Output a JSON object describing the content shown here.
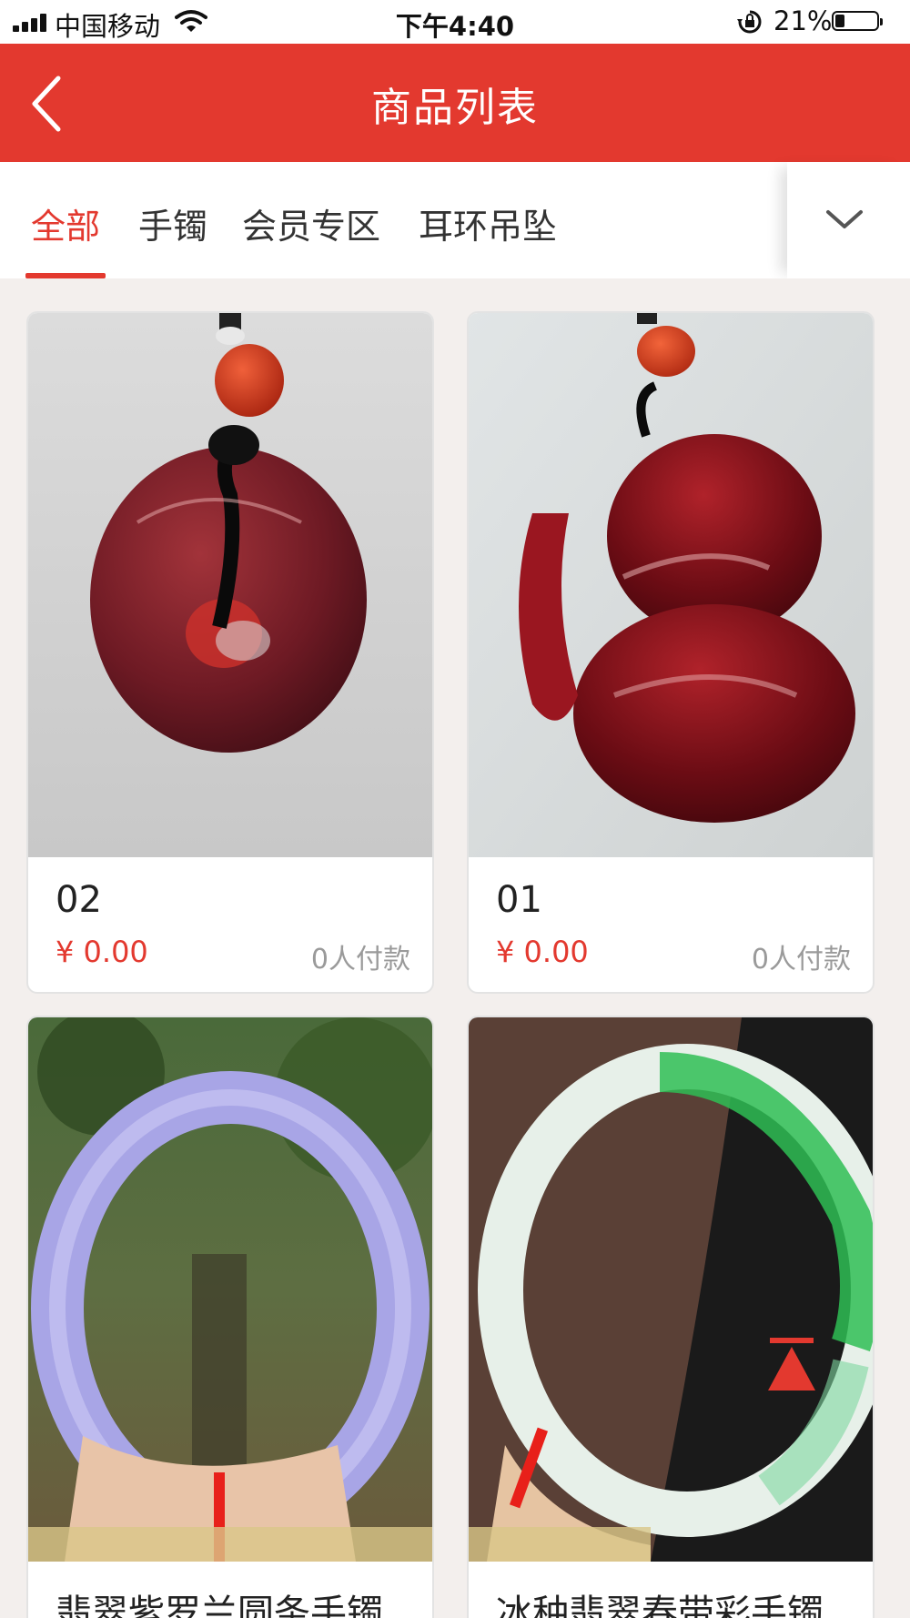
{
  "status_bar": {
    "carrier": "中国移动",
    "time": "下午4:40",
    "battery": "21%"
  },
  "header": {
    "title": "商品列表"
  },
  "tabs": [
    {
      "label": "全部",
      "active": true
    },
    {
      "label": "手镯",
      "active": false
    },
    {
      "label": "会员专区",
      "active": false
    },
    {
      "label": "耳环吊坠",
      "active": false
    }
  ],
  "products": [
    {
      "name": "02",
      "price": "¥ 0.00",
      "sold": "0人付款",
      "image": "red-agate-donut-pendant"
    },
    {
      "name": "01",
      "price": "¥ 0.00",
      "sold": "0人付款",
      "image": "red-agate-gourd-pendant"
    },
    {
      "name": "翡翠紫罗兰圆条手镯",
      "price": "",
      "sold": "",
      "image": "lavender-jade-bangle"
    },
    {
      "name": "冰种翡翠春带彩手镯",
      "price": "",
      "sold": "",
      "image": "green-jade-bangle"
    }
  ],
  "colors": {
    "brand": "#e3392f",
    "price": "#e3392f",
    "background": "#f3efed"
  },
  "icons": [
    "back-arrow-icon",
    "chevron-down-icon",
    "back-to-top-icon",
    "wifi-icon",
    "signal-icon",
    "rotation-lock-icon",
    "battery-icon"
  ]
}
